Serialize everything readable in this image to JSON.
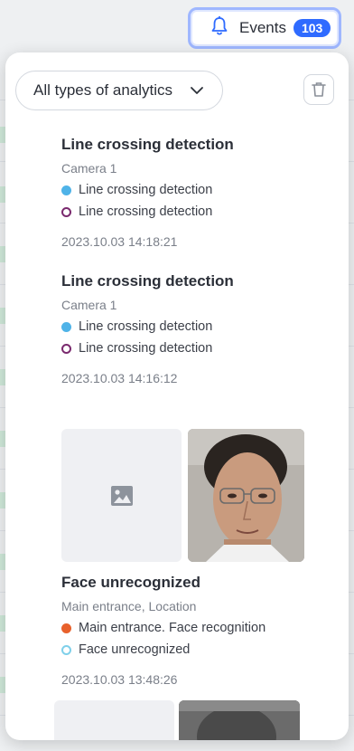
{
  "events_button": {
    "label": "Events",
    "count": "103",
    "icon": "bell-icon"
  },
  "filter": {
    "label": "All types of analytics",
    "icon": "chevron-down-icon"
  },
  "clear_icon": "trash-icon",
  "events": [
    {
      "title": "Line crossing detection",
      "source": "Camera 1",
      "line1": {
        "text": "Line crossing detection",
        "dot": "filled",
        "color": "#4fb3e8"
      },
      "line2": {
        "text": "Line crossing detection",
        "dot": "ring",
        "color": "#7a2a6e"
      },
      "time": "2023.10.03 14:18:21"
    },
    {
      "title": "Line crossing detection",
      "source": "Camera 1",
      "line1": {
        "text": "Line crossing detection",
        "dot": "filled",
        "color": "#4fb3e8"
      },
      "line2": {
        "text": "Line crossing detection",
        "dot": "ring",
        "color": "#7a2a6e"
      },
      "time": "2023.10.03 14:16:12"
    },
    {
      "title": "Face unrecognized",
      "source": "Main entrance, Location",
      "line1": {
        "text": "Main entrance. Face recognition",
        "dot": "filled",
        "color": "#e8612c"
      },
      "line2": {
        "text": "Face unrecognized",
        "dot": "ring",
        "color": "#7fd0ea"
      },
      "time": "2023.10.03 13:48:26"
    }
  ]
}
